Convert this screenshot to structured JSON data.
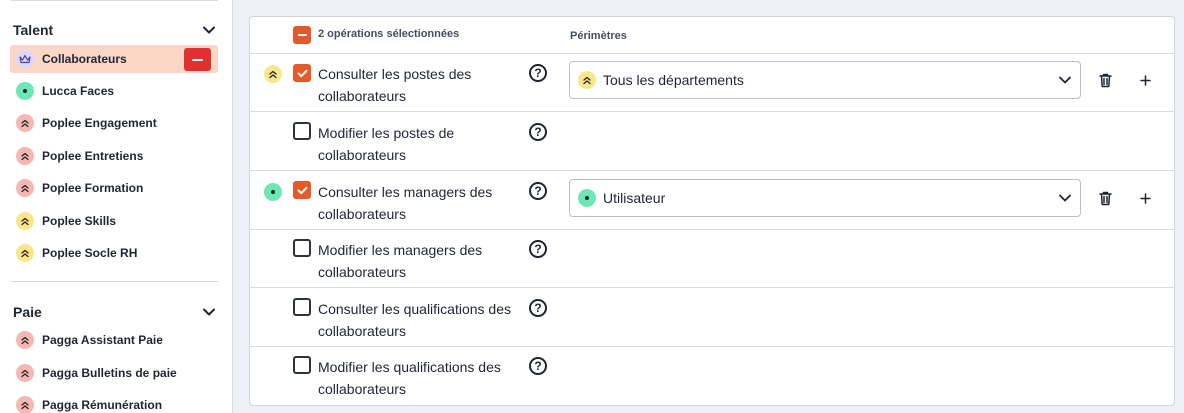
{
  "sidebar": {
    "talent": {
      "title": "Talent",
      "items": [
        {
          "label": "Collaborateurs",
          "icon": "crown-icon",
          "color": "#ddd8f8"
        },
        {
          "label": "Lucca Faces",
          "icon": "dot-icon",
          "color": "#6ee7b7"
        },
        {
          "label": "Poplee Engagement",
          "icon": "double-chevron-up-icon",
          "color": "#f7b8b3"
        },
        {
          "label": "Poplee Entretiens",
          "icon": "double-chevron-up-icon",
          "color": "#f7b8b3"
        },
        {
          "label": "Poplee Formation",
          "icon": "double-chevron-up-icon",
          "color": "#f7b8b3"
        },
        {
          "label": "Poplee Skills",
          "icon": "double-chevron-up-icon",
          "color": "#fbe68c"
        },
        {
          "label": "Poplee Socle RH",
          "icon": "double-chevron-up-icon",
          "color": "#fbe68c"
        }
      ]
    },
    "paie": {
      "title": "Paie",
      "items": [
        {
          "label": "Pagga Assistant Paie",
          "icon": "double-chevron-up-icon",
          "color": "#f7b8b3"
        },
        {
          "label": "Pagga Bulletins de paie",
          "icon": "double-chevron-up-icon",
          "color": "#f7b8b3"
        },
        {
          "label": "Pagga Rémunération",
          "icon": "double-chevron-up-icon",
          "color": "#f7b8b3"
        }
      ]
    }
  },
  "table": {
    "selected_label": "2 opérations sélectionnées",
    "scope_header": "Périmètres",
    "rows": [
      {
        "label": "Consulter les postes des collaborateurs",
        "checked": true,
        "scope": "Tous les départements"
      },
      {
        "label": "Modifier les postes de collaborateurs",
        "checked": false
      },
      {
        "label": "Consulter les managers des collaborateurs",
        "checked": true,
        "scope": "Utilisateur"
      },
      {
        "label": "Modifier les managers des collaborateurs",
        "checked": false
      },
      {
        "label": "Consulter les qualifications des collaborateurs",
        "checked": false
      },
      {
        "label": "Modifier les qualifications des collaborateurs",
        "checked": false
      }
    ]
  },
  "colors": {
    "accent": "#e55a2b",
    "danger": "#e03131",
    "active_bg": "#fcd6c6",
    "main_bg": "#eef0f8"
  }
}
